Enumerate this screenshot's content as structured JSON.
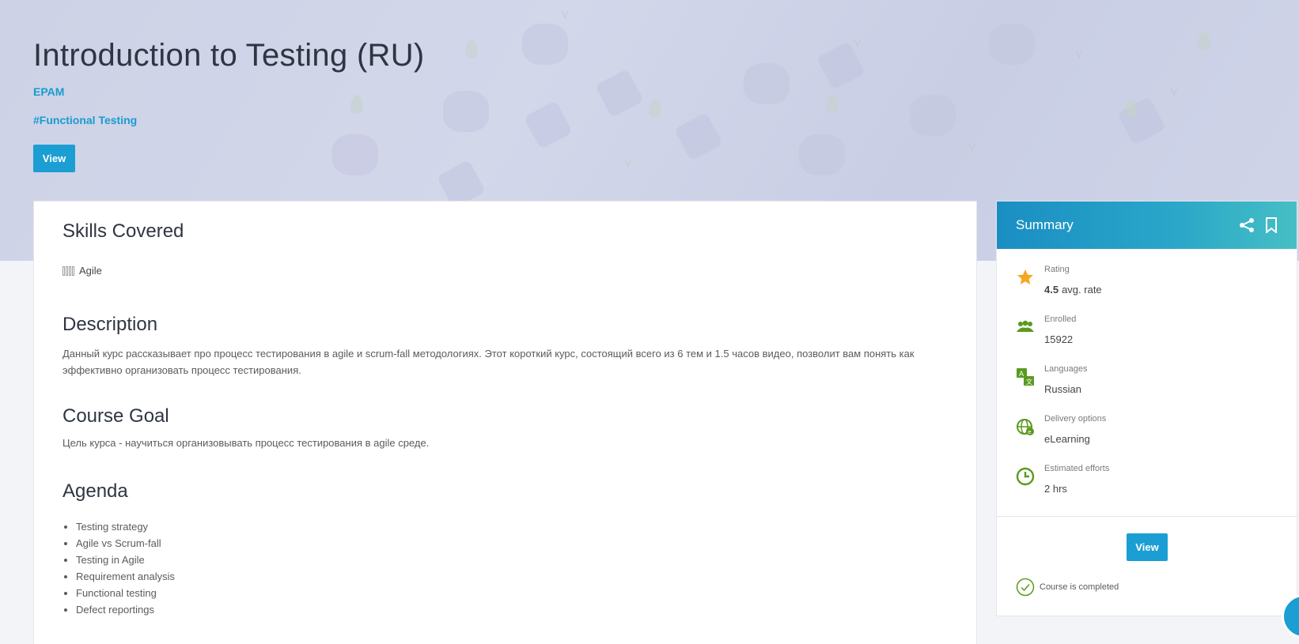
{
  "hero": {
    "title": "Introduction to Testing (RU)",
    "provider": "EPAM",
    "tag": "#Functional Testing",
    "view_label": "View"
  },
  "skills": {
    "title": "Skills Covered",
    "items": [
      "Agile"
    ]
  },
  "description": {
    "title": "Description",
    "text": "Данный курс рассказывает про процесс тестирования в agile и scrum-fall методологиях. Этот короткий курс, состоящий всего из 6 тем и 1.5 часов видео, позволит вам понять как эффективно организовать процесс тестирования."
  },
  "goal": {
    "title": "Course Goal",
    "text": "Цель курса - научиться организовывать процесс тестирования в agile среде."
  },
  "agenda": {
    "title": "Agenda",
    "items": [
      "Testing strategy",
      "Agile vs Scrum-fall",
      "Testing in Agile",
      "Requirement analysis",
      "Functional testing",
      "Defect reportings"
    ]
  },
  "summary": {
    "title": "Summary",
    "rating_label": "Rating",
    "rating_value": "4.5",
    "rating_suffix": "avg. rate",
    "enrolled_label": "Enrolled",
    "enrolled_value": "15922",
    "languages_label": "Languages",
    "languages_value": "Russian",
    "delivery_label": "Delivery options",
    "delivery_value": "eLearning",
    "efforts_label": "Estimated efforts",
    "efforts_value": "2 hrs",
    "view_label": "View",
    "completed_text": "Course is completed"
  },
  "colors": {
    "accent": "#1b9ed3",
    "icon_green": "#5a9a1f",
    "star": "#f5a623"
  }
}
